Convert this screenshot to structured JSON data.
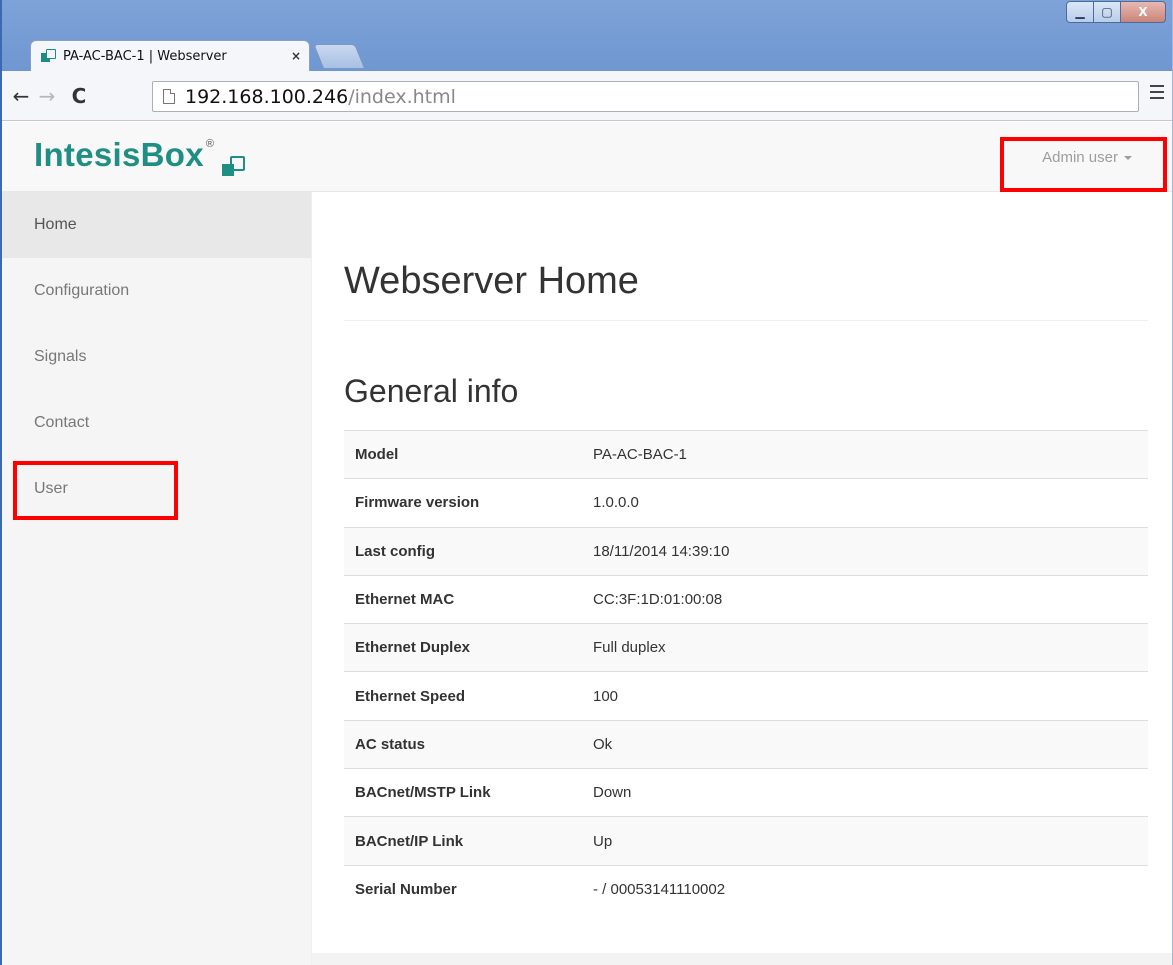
{
  "browser": {
    "tab_title": "PA-AC-BAC-1 | Webserver",
    "tab_close": "×",
    "url_host": "192.168.100.246",
    "url_path": "/index.html",
    "window_controls": [
      "minimize-icon",
      "maximize-icon",
      "close-icon"
    ]
  },
  "header": {
    "brand": "IntesisBox",
    "brand_mark": "®",
    "user_menu": "Admin user"
  },
  "sidebar": {
    "items": [
      {
        "label": "Home",
        "active": true
      },
      {
        "label": "Configuration"
      },
      {
        "label": "Signals"
      },
      {
        "label": "Contact"
      },
      {
        "label": "User"
      }
    ]
  },
  "main": {
    "title": "Webserver Home",
    "section_title": "General info",
    "rows": [
      {
        "label": "Model",
        "value": "PA-AC-BAC-1"
      },
      {
        "label": "Firmware version",
        "value": "1.0.0.0"
      },
      {
        "label": "Last config",
        "value": "18/11/2014 14:39:10"
      },
      {
        "label": "Ethernet MAC",
        "value": "CC:3F:1D:01:00:08"
      },
      {
        "label": "Ethernet Duplex",
        "value": "Full duplex"
      },
      {
        "label": "Ethernet Speed",
        "value": "100"
      },
      {
        "label": "AC status",
        "value": "Ok"
      },
      {
        "label": "BACnet/MSTP Link",
        "value": "Down"
      },
      {
        "label": "BACnet/IP Link",
        "value": "Up"
      },
      {
        "label": "Serial Number",
        "value": "- / 00053141110002"
      }
    ]
  },
  "colors": {
    "brand": "#1f8e83",
    "highlight": "#ff0000"
  }
}
